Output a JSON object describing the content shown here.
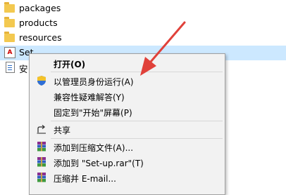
{
  "files": [
    {
      "label": "packages",
      "icon": "folder-icon"
    },
    {
      "label": "products",
      "icon": "folder-icon"
    },
    {
      "label": "resources",
      "icon": "folder-icon"
    },
    {
      "label": "Set",
      "icon": "adobe-app-icon"
    },
    {
      "label": "安",
      "icon": "document-icon"
    }
  ],
  "app_icon_glyph": "A",
  "context_menu": {
    "items": [
      {
        "label": "打开(O)",
        "icon": null
      },
      {
        "label": "以管理员身份运行(A)",
        "icon": "shield-icon"
      },
      {
        "label": "兼容性疑难解答(Y)",
        "icon": null
      },
      {
        "label": "固定到\"开始\"屏幕(P)",
        "icon": null
      },
      {
        "label": "共享",
        "icon": "share-icon"
      },
      {
        "label": "添加到压缩文件(A)...",
        "icon": "winrar-icon"
      },
      {
        "label": "添加到 \"Set-up.rar\"(T)",
        "icon": "winrar-icon"
      },
      {
        "label": "压缩并 E-mail...",
        "icon": "winrar-icon"
      }
    ]
  },
  "colors": {
    "selection": "#cce8ff",
    "arrow": "#e0413a",
    "folder": "#f3c950"
  }
}
